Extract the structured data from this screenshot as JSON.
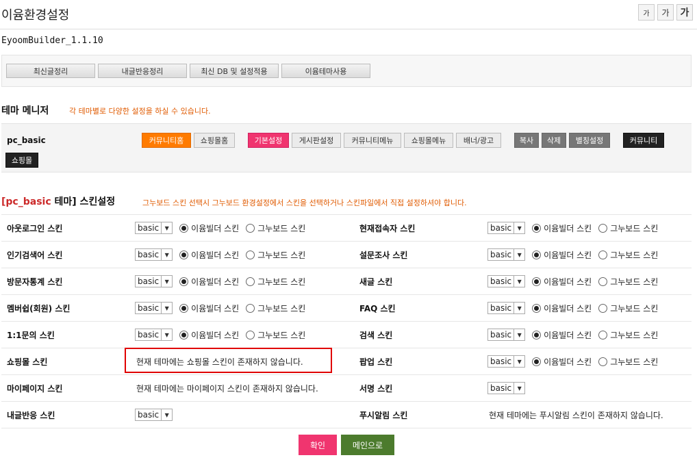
{
  "page_title": "이윰환경설정",
  "font_buttons": [
    "가",
    "가",
    "가"
  ],
  "version": "EyoomBuilder_1.1.10",
  "tools": [
    "최신글정리",
    "내글반응정리",
    "최신 DB 및 설정적용",
    "이윰테마사용"
  ],
  "theme_manager": {
    "title": "테마 메니저",
    "note": "각 테마별로 다양한 설정을 하실 수 있습니다.",
    "theme_name": "pc_basic",
    "buttons": {
      "community_home": "커뮤니티홈",
      "shop_home": "쇼핑몰홈",
      "basic_settings": "기본설정",
      "board_settings": "게시판설정",
      "community_menu": "커뮤니티메뉴",
      "shop_menu": "쇼핑몰메뉴",
      "banner_ad": "배너/광고",
      "copy": "복사",
      "delete": "삭제",
      "alias": "별칭설정",
      "community": "커뮤니티",
      "shop": "쇼핑몰"
    }
  },
  "skin_settings": {
    "title_bracket_open": "[",
    "title_theme": "pc_basic",
    "title_theme_suffix": " 테마]",
    "title_rest": " 스킨설정",
    "note": "그누보드 스킨 선택시 그누보드 환경설정에서 스킨을 선택하거나 스킨파일에서 직접 설정하셔야 합니다.",
    "select_value": "basic",
    "radio_eyoom": "이윰빌더 스킨",
    "radio_gnu": "그누보드 스킨",
    "rows": [
      {
        "left_label": "아웃로그인 스킨",
        "right_label": "현재접속자 스킨"
      },
      {
        "left_label": "인기검색어 스킨",
        "right_label": "설문조사 스킨"
      },
      {
        "left_label": "방문자통계 스킨",
        "right_label": "새글 스킨"
      },
      {
        "left_label": "멤버쉽(회원) 스킨",
        "right_label": "FAQ 스킨"
      },
      {
        "left_label": "1:1문의 스킨",
        "right_label": "검색 스킨"
      },
      {
        "left_label": "쇼핑몰 스킨",
        "left_msg": "현재 테마에는 쇼핑몰 스킨이 존재하지 않습니다.",
        "right_label": "팝업 스킨"
      },
      {
        "left_label": "마이페이지 스킨",
        "left_msg": "현재 테마에는 마이페이지 스킨이 존재하지 않습니다.",
        "right_label": "서명 스킨"
      },
      {
        "left_label": "내글반응 스킨",
        "right_label": "푸시알림 스킨",
        "right_msg": "현재 테마에는 푸시알림 스킨이 존재하지 않습니다."
      }
    ]
  },
  "footer": {
    "confirm": "확인",
    "main": "메인으로"
  },
  "colors": {
    "accent_pink": "#f0356f",
    "accent_orange": "#ff7b00",
    "green": "#4c7b2d",
    "highlight_red": "#e00000"
  }
}
